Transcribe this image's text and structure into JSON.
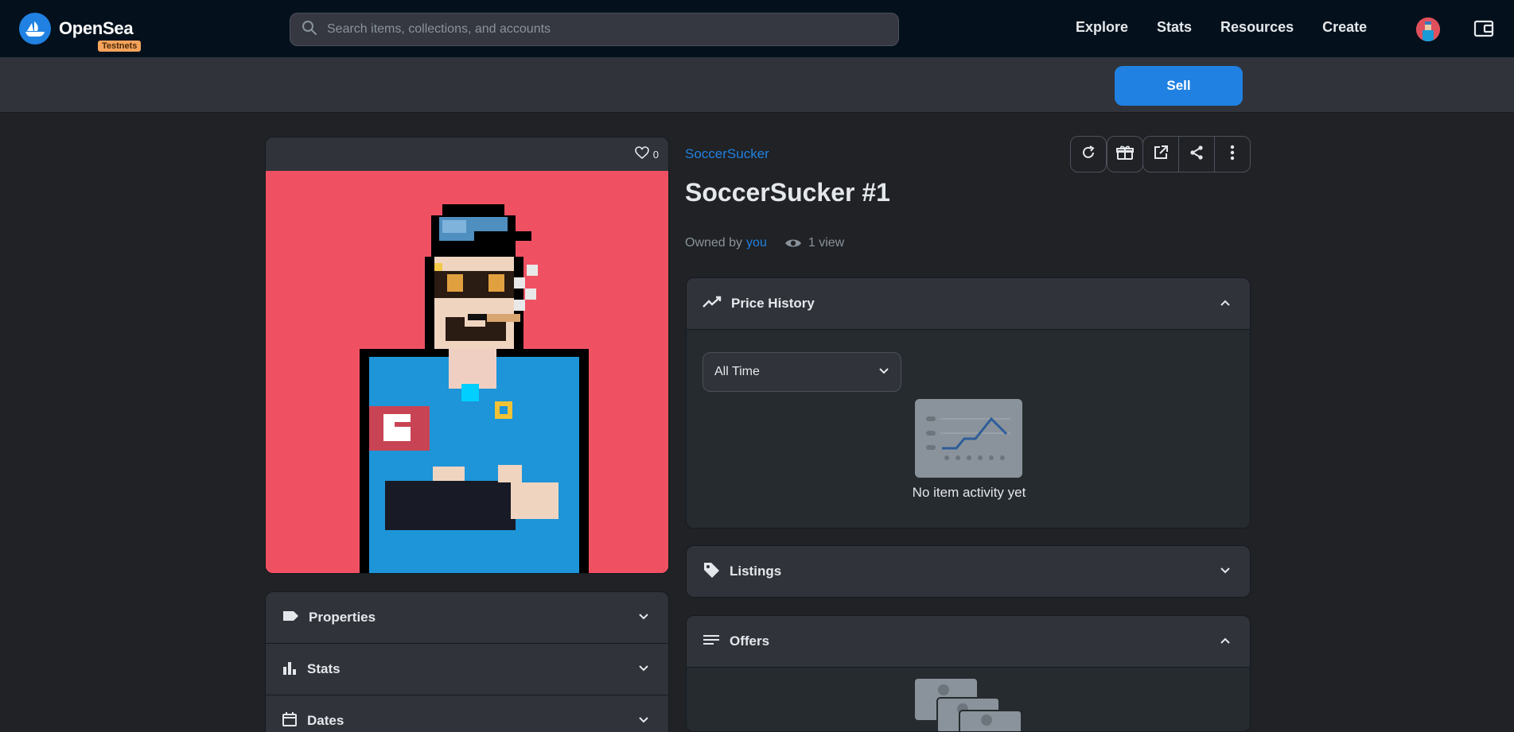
{
  "header": {
    "brand": "OpenSea",
    "badge": "Testnets",
    "search_placeholder": "Search items, collections, and accounts",
    "nav": [
      "Explore",
      "Stats",
      "Resources",
      "Create"
    ]
  },
  "sellbar": {
    "sell_label": "Sell"
  },
  "item": {
    "favorites": "0",
    "collection": "SoccerSucker",
    "title": "SoccerSucker #1",
    "owned_by": "Owned by",
    "owner": "you",
    "views": "1 view"
  },
  "left_sections": [
    "Properties",
    "Stats",
    "Dates"
  ],
  "price_history": {
    "title": "Price History",
    "period": "All Time",
    "empty": "No item activity yet"
  },
  "listings": {
    "title": "Listings"
  },
  "offers": {
    "title": "Offers"
  },
  "colors": {
    "accent": "#2081e2",
    "nft_bg": "#f05162",
    "navbar": "#04111d"
  }
}
